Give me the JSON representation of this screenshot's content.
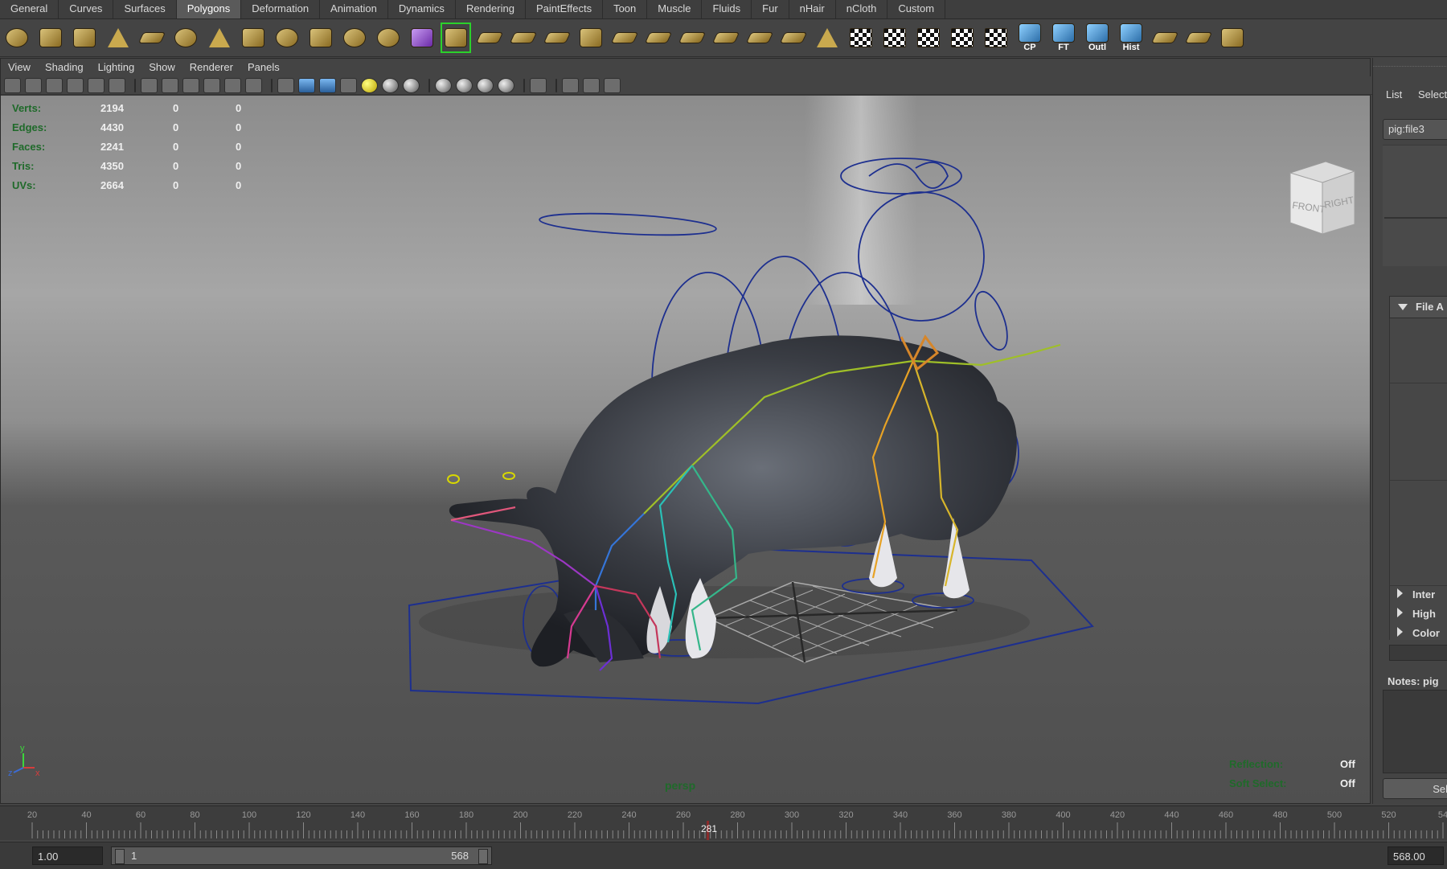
{
  "shelf": {
    "tabs": [
      "General",
      "Curves",
      "Surfaces",
      "Polygons",
      "Deformation",
      "Animation",
      "Dynamics",
      "Rendering",
      "PaintEffects",
      "Toon",
      "Muscle",
      "Fluids",
      "Fur",
      "nHair",
      "nCloth",
      "Custom"
    ],
    "active_tab": "Polygons",
    "icons": [
      {
        "name": "poly-sphere-icon",
        "style": "round",
        "label": ""
      },
      {
        "name": "poly-cube-icon",
        "style": "",
        "label": ""
      },
      {
        "name": "poly-cylinder-icon",
        "style": "",
        "label": ""
      },
      {
        "name": "poly-cone-icon",
        "style": "tri",
        "label": ""
      },
      {
        "name": "poly-plane-icon",
        "style": "flat",
        "label": ""
      },
      {
        "name": "poly-torus-icon",
        "style": "round",
        "label": ""
      },
      {
        "name": "poly-pyramid-icon",
        "style": "tri",
        "label": ""
      },
      {
        "name": "poly-pipe-icon",
        "style": "",
        "label": ""
      },
      {
        "name": "poly-soccer-ball-icon",
        "style": "round",
        "label": ""
      },
      {
        "name": "combine-icon",
        "style": "",
        "label": ""
      },
      {
        "name": "separate-icon",
        "style": "round",
        "label": ""
      },
      {
        "name": "extract-icon",
        "style": "round",
        "label": ""
      },
      {
        "name": "smooth-proxy-icon",
        "style": "purple",
        "label": ""
      },
      {
        "name": "smooth-icon",
        "style": "",
        "label": "",
        "selected": true
      },
      {
        "name": "append-polygon-icon",
        "style": "flat",
        "label": ""
      },
      {
        "name": "split-polygon-icon",
        "style": "flat",
        "label": ""
      },
      {
        "name": "extrude-face-icon",
        "style": "flat",
        "label": ""
      },
      {
        "name": "bevel-icon",
        "style": "",
        "label": ""
      },
      {
        "name": "bridge-icon",
        "style": "flat",
        "label": ""
      },
      {
        "name": "insert-edge-loop-icon",
        "style": "flat",
        "label": ""
      },
      {
        "name": "offset-edge-loop-icon",
        "style": "flat",
        "label": ""
      },
      {
        "name": "merge-icon",
        "style": "flat",
        "label": ""
      },
      {
        "name": "collapse-icon",
        "style": "flat",
        "label": ""
      },
      {
        "name": "fill-hole-icon",
        "style": "flat",
        "label": ""
      },
      {
        "name": "sculpt-icon",
        "style": "tri",
        "label": ""
      },
      {
        "name": "planar-map-icon",
        "style": "check",
        "label": ""
      },
      {
        "name": "cylindrical-map-icon",
        "style": "check",
        "label": ""
      },
      {
        "name": "spherical-map-icon",
        "style": "check",
        "label": ""
      },
      {
        "name": "automatic-map-icon",
        "style": "check",
        "label": ""
      },
      {
        "name": "uv-texture-editor-icon",
        "style": "check",
        "label": ""
      },
      {
        "name": "center-pivot-icon",
        "style": "blue",
        "label": "CP"
      },
      {
        "name": "freeze-transform-icon",
        "style": "blue",
        "label": "FT"
      },
      {
        "name": "outliner-icon",
        "style": "blue",
        "label": "Outl"
      },
      {
        "name": "history-icon",
        "style": "blue",
        "label": "Hist"
      },
      {
        "name": "mirror-icon",
        "style": "flat",
        "label": ""
      },
      {
        "name": "cut-faces-icon",
        "style": "flat",
        "label": ""
      },
      {
        "name": "checker-grid-icon",
        "style": "",
        "label": ""
      }
    ]
  },
  "panel": {
    "menus": [
      "View",
      "Shading",
      "Lighting",
      "Show",
      "Renderer",
      "Panels"
    ]
  },
  "hud": {
    "rows": [
      {
        "label": "Verts:",
        "v1": "2194",
        "v2": "0",
        "v3": "0"
      },
      {
        "label": "Edges:",
        "v1": "4430",
        "v2": "0",
        "v3": "0"
      },
      {
        "label": "Faces:",
        "v1": "2241",
        "v2": "0",
        "v3": "0"
      },
      {
        "label": "Tris:",
        "v1": "4350",
        "v2": "0",
        "v3": "0"
      },
      {
        "label": "UVs:",
        "v1": "2664",
        "v2": "0",
        "v3": "0"
      }
    ],
    "camera": "persp",
    "reflection_label": "Reflection:",
    "reflection_value": "Off",
    "soft_select_label": "Soft Select:",
    "soft_select_value": "Off"
  },
  "view_cube": {
    "front": "FRONT",
    "right": "RIGHT"
  },
  "axis": {
    "y": "y",
    "z": "z",
    "x": "x"
  },
  "right_panel": {
    "list": "List",
    "selected": "Selecte",
    "node_tab": "pig:file3",
    "section": "File A",
    "collapsed": [
      "Inter",
      "High",
      "Color"
    ],
    "notes": "Notes: pig",
    "select_button": "Sel"
  },
  "timeline": {
    "ticks": [
      "20",
      "40",
      "60",
      "80",
      "100",
      "120",
      "140",
      "160",
      "180",
      "200",
      "220",
      "240",
      "260",
      "280",
      "300",
      "320",
      "340",
      "360",
      "380",
      "400",
      "420",
      "440",
      "460",
      "480",
      "500",
      "520",
      "54"
    ],
    "current_frame": "281",
    "current_fraction": 0.5
  },
  "range": {
    "start_field": "1.00",
    "slider_start": "1",
    "slider_end": "568",
    "end_field": "568.00"
  },
  "colors": {
    "hud_label": "#1f6a2a",
    "curve_blue": "#1d2f8f",
    "timeline_mark": "#8a2b2b"
  }
}
